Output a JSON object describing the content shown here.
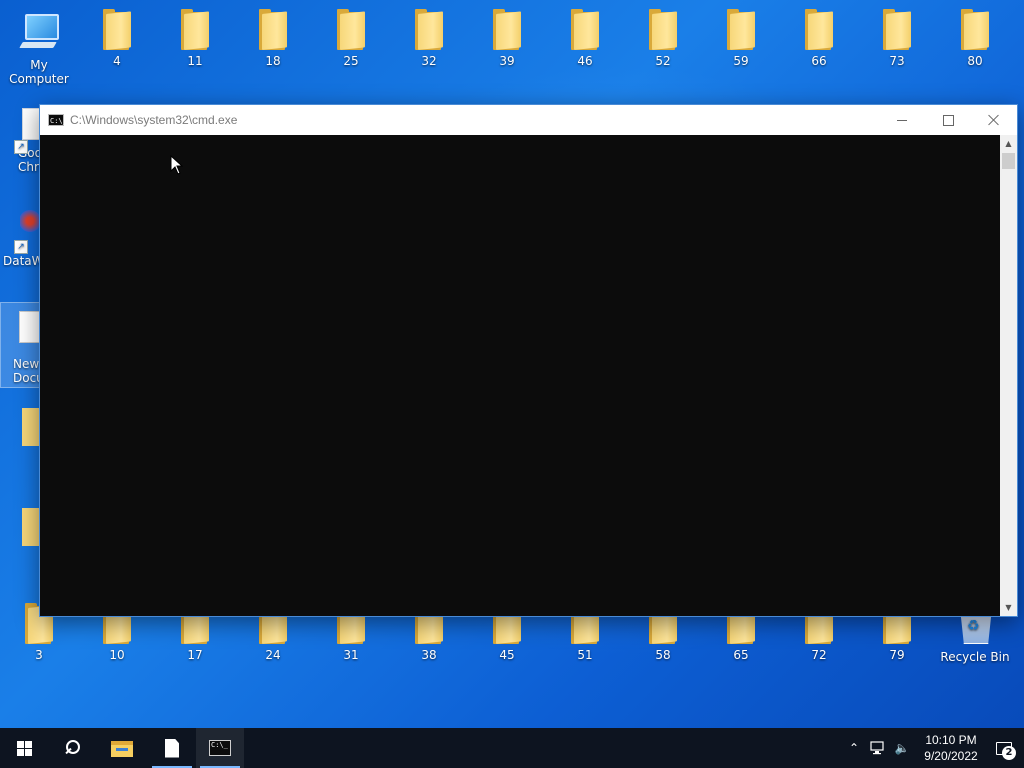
{
  "desktop": {
    "top_row": [
      {
        "label": "My Computer",
        "type": "computer"
      },
      {
        "label": "4"
      },
      {
        "label": "11"
      },
      {
        "label": "18"
      },
      {
        "label": "25"
      },
      {
        "label": "32"
      },
      {
        "label": "39"
      },
      {
        "label": "46"
      },
      {
        "label": "52"
      },
      {
        "label": "59"
      },
      {
        "label": "66"
      },
      {
        "label": "73"
      },
      {
        "label": "80"
      }
    ],
    "left_column_partial": [
      {
        "label": "Goo\nChro"
      },
      {
        "label": "DataW"
      },
      {
        "label": "New\nDocu"
      }
    ],
    "bottom_row": [
      {
        "label": "3"
      },
      {
        "label": "10"
      },
      {
        "label": "17"
      },
      {
        "label": "24"
      },
      {
        "label": "31"
      },
      {
        "label": "38"
      },
      {
        "label": "45"
      },
      {
        "label": "51"
      },
      {
        "label": "58"
      },
      {
        "label": "65"
      },
      {
        "label": "72"
      },
      {
        "label": "79"
      },
      {
        "label": "Recycle Bin",
        "type": "recycle"
      }
    ]
  },
  "cmd_window": {
    "title": "C:\\Windows\\system32\\cmd.exe",
    "icon_text": "C:\\_",
    "content": ""
  },
  "taskbar": {
    "tray_up_glyph": "⌃",
    "tray_volume_glyph": "🔈",
    "clock_time": "10:10 PM",
    "clock_date": "9/20/2022",
    "notification_count": "2",
    "cmd_icon_text": "C:\\_"
  },
  "colors": {
    "desktop_blue": "#0a5fd0",
    "taskbar_bg": "#0d1420",
    "console_bg": "#0c0c0c",
    "folder_yellow": "#f7d77a"
  }
}
